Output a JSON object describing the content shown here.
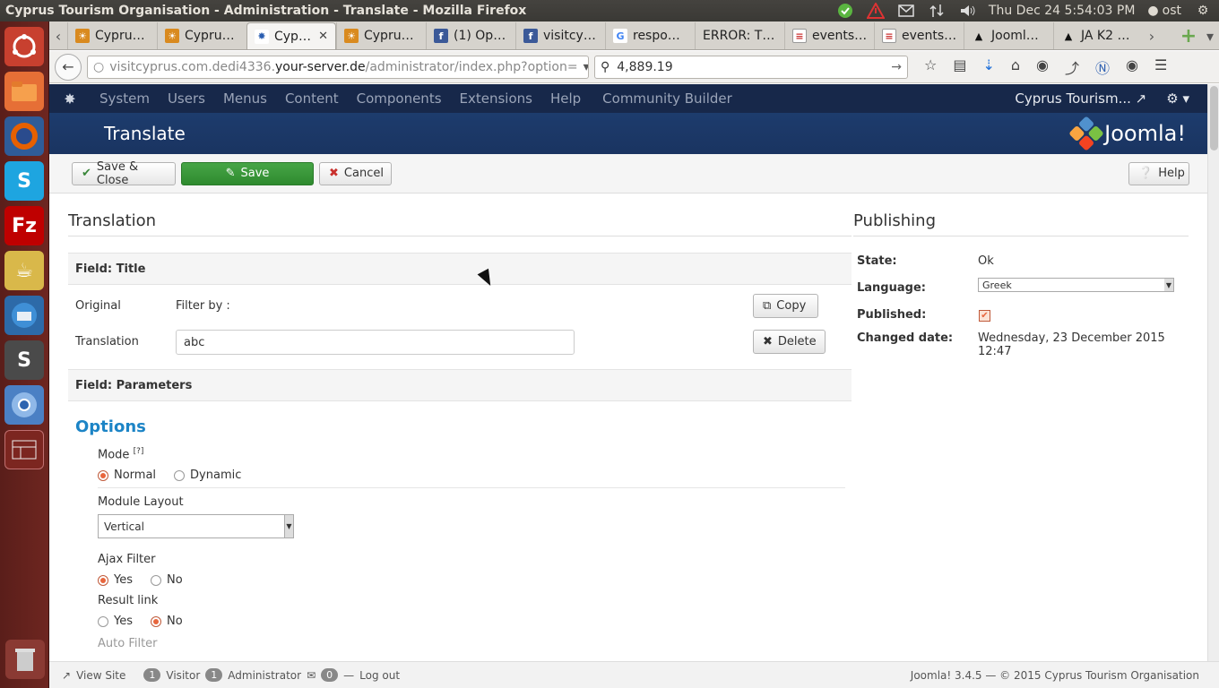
{
  "os": {
    "window_title": "Cyprus Tourism Organisation - Administration - Translate - Mozilla Firefox",
    "datetime": "Thu Dec 24  5:54:03 PM",
    "user": "ost"
  },
  "launcher": {
    "items": [
      "ubuntu-home",
      "files",
      "firefox",
      "skype",
      "filezilla",
      "gajim",
      "thunderbird",
      "sublime-text",
      "chromium",
      "workspace-switcher",
      "trash"
    ]
  },
  "browser": {
    "tabs": [
      {
        "label": "Cypru…",
        "icon": "cyprus-icon"
      },
      {
        "label": "Cypru…",
        "icon": "cyprus-icon"
      },
      {
        "label": "Cyp…",
        "icon": "joomla-icon",
        "active": true
      },
      {
        "label": "Cypru…",
        "icon": "cyprus-icon"
      },
      {
        "label": "(1) Op…",
        "icon": "facebook-icon"
      },
      {
        "label": "visitcy…",
        "icon": "facebook-icon"
      },
      {
        "label": "respo…",
        "icon": "google-icon"
      },
      {
        "label": "ERROR: T…",
        "icon": ""
      },
      {
        "label": "events…",
        "icon": "doc-icon"
      },
      {
        "label": "events…",
        "icon": "doc-icon"
      },
      {
        "label": "Jooml…",
        "icon": "ja-icon"
      },
      {
        "label": "JA K2 …",
        "icon": "ja-icon"
      }
    ],
    "url_prefix": "visitcyprus.com.dedi4336.",
    "url_domain": "your-server.de",
    "url_path": "/administrator/index.php?option=",
    "search_value": "4,889.19"
  },
  "joomla": {
    "nav": [
      "System",
      "Users",
      "Menus",
      "Content",
      "Components",
      "Extensions",
      "Help",
      "Community Builder"
    ],
    "site_link": "Cyprus Tourism...",
    "page_title": "Translate",
    "brand": "Joomla!",
    "toolbar": {
      "save_close": "Save & Close",
      "save": "Save",
      "cancel": "Cancel",
      "help": "Help"
    }
  },
  "translation": {
    "section_title": "Translation",
    "field_title_head": "Field: Title",
    "original_label": "Original",
    "original_value": "Filter by :",
    "copy_label": "Copy",
    "translation_label": "Translation",
    "translation_value": "abc",
    "delete_label": "Delete",
    "field_params_head": "Field: Parameters",
    "options_title": "Options",
    "mode_label": "Mode",
    "mode_help": "[?]",
    "mode_normal": "Normal",
    "mode_dynamic": "Dynamic",
    "module_layout_label": "Module Layout",
    "module_layout_value": "Vertical",
    "ajax_filter_label": "Ajax Filter",
    "result_link_label": "Result link",
    "yes": "Yes",
    "no": "No",
    "auto_filter_label": "Auto Filter"
  },
  "publishing": {
    "section_title": "Publishing",
    "state_label": "State:",
    "state_value": "Ok",
    "language_label": "Language:",
    "language_value": "Greek",
    "published_label": "Published:",
    "changed_label": "Changed date:",
    "changed_value": "Wednesday, 23 December 2015 12:47"
  },
  "status": {
    "view_site": "View Site",
    "visitor_count": "1",
    "visitor": "Visitor",
    "admin_count": "1",
    "administrator": "Administrator",
    "mail_count": "0",
    "logout": "Log out",
    "footer": "Joomla! 3.4.5  —  © 2015 Cyprus Tourism Organisation"
  },
  "colors": {
    "joomla_nav": "#17284a",
    "joomla_header": "#1d3c6d",
    "save_green": "#46a546",
    "options_blue": "#1c84c6",
    "radio_orange": "#e8663d",
    "launcher": "#6e2620"
  }
}
